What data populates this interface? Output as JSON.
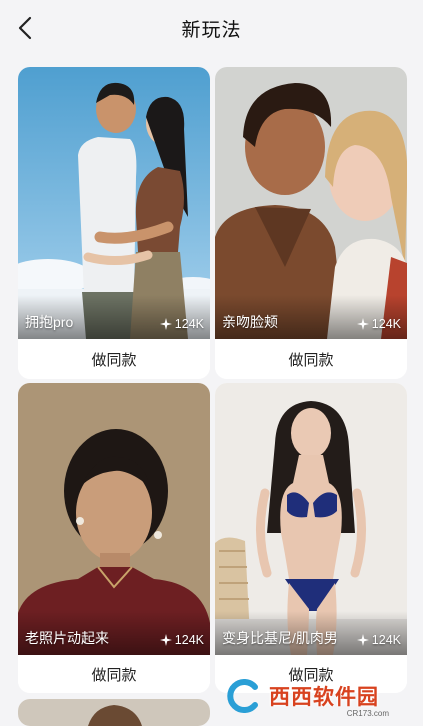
{
  "header": {
    "title": "新玩法",
    "back_icon": "chevron-left-icon"
  },
  "cards": [
    {
      "name": "拥抱pro",
      "stat": "124K",
      "button_label": "做同款"
    },
    {
      "name": "亲吻脸颊",
      "stat": "124K",
      "button_label": "做同款"
    },
    {
      "name": "老照片动起来",
      "stat": "124K",
      "button_label": "做同款"
    },
    {
      "name": "变身比基尼/肌肉男",
      "stat": "124K",
      "button_label": "做同款"
    }
  ],
  "watermark": {
    "text": "西西软件园",
    "url": "CR173.com"
  },
  "colors": {
    "background": "#f4f4f6",
    "card": "#ffffff",
    "watermark": "#d8421f"
  }
}
